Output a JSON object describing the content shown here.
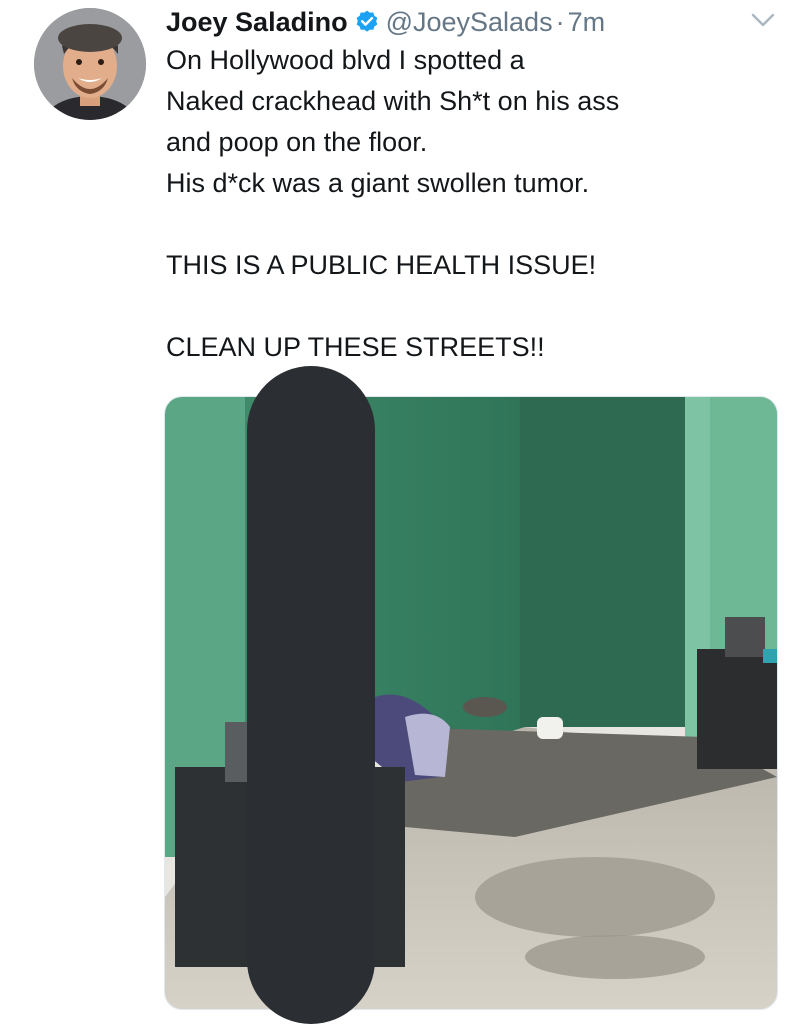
{
  "tweet": {
    "display_name": "Joey Saladino",
    "handle": "@JoeySalads",
    "separator": "·",
    "timestamp": "7m",
    "text_lines": [
      "On Hollywood blvd I spotted a",
      "Naked crackhead with Sh*t on his ass",
      "and poop on the floor.",
      "His d*ck was a giant swollen tumor.",
      "",
      "THIS IS A PUBLIC HEALTH ISSUE!",
      "",
      "CLEAN UP THESE STREETS!!"
    ]
  },
  "icons": {
    "verified": "verified-badge-icon",
    "menu": "chevron-down-icon"
  },
  "colors": {
    "verified_blue": "#1da1f2",
    "secondary_text": "#657786",
    "primary_text": "#14171a",
    "redaction": "#2b2e32",
    "wall_green": "#4f9c7c"
  }
}
